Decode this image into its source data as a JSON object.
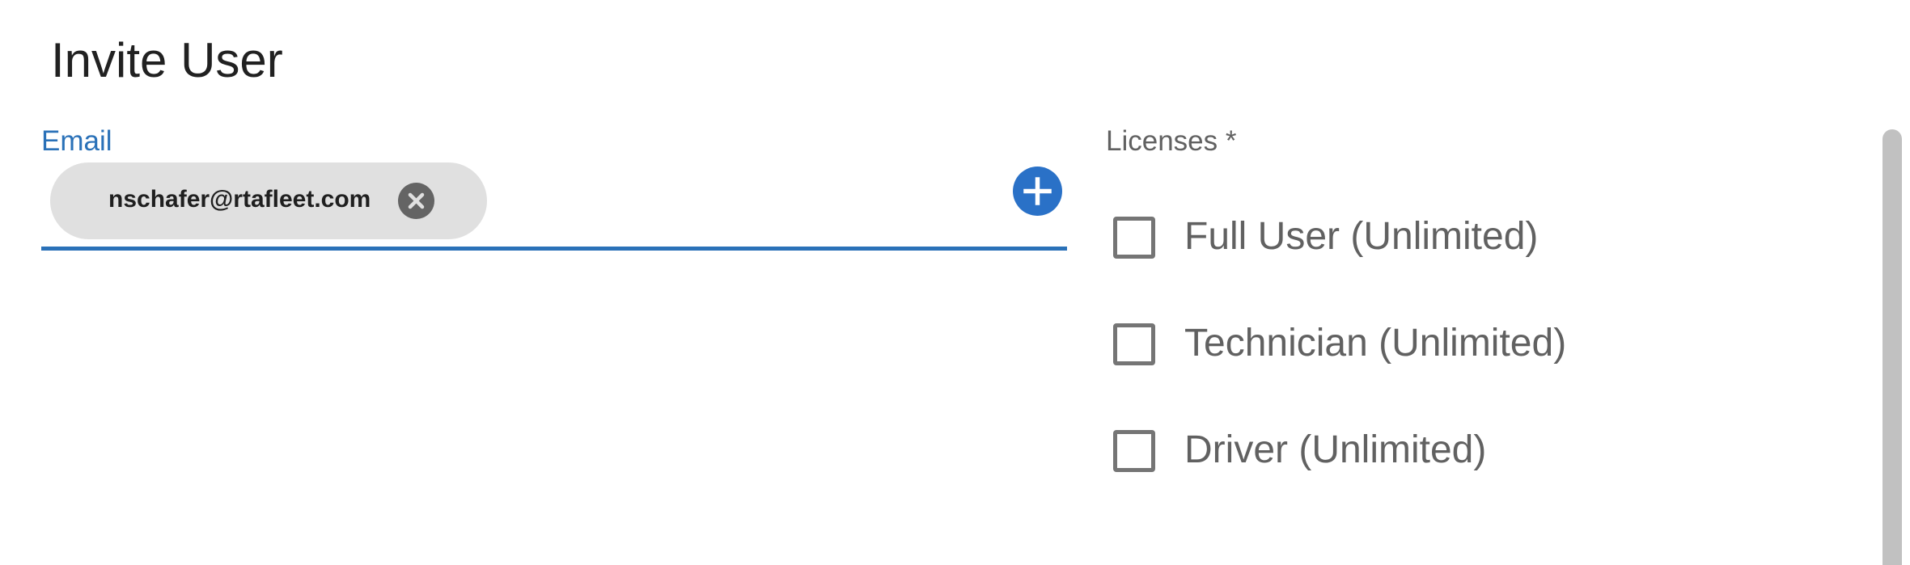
{
  "dialog": {
    "title": "Invite User"
  },
  "email": {
    "label": "Email",
    "chips": [
      {
        "value": "nschafer@rtafleet.com",
        "remove_icon": "cancel-circle-icon"
      }
    ],
    "add_icon": "plus-circle-icon",
    "accent_color": "#2a71b8"
  },
  "licenses": {
    "label": "Licenses *",
    "options": [
      {
        "label": "Full User (Unlimited)",
        "checked": false
      },
      {
        "label": "Technician (Unlimited)",
        "checked": false
      },
      {
        "label": "Driver (Unlimited)",
        "checked": false
      }
    ]
  }
}
